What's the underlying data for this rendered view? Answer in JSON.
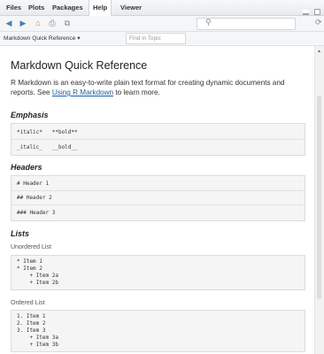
{
  "tabs": [
    "Files",
    "Plots",
    "Packages",
    "Help",
    "Viewer"
  ],
  "active_tab": "Help",
  "topic": "Markdown Quick Reference",
  "find_placeholder": "Find in Topic",
  "doc": {
    "title": "Markdown Quick Reference",
    "intro_text": "R Markdown is an easy-to-write plain text format for creating dynamic documents and reports. See ",
    "intro_link": "Using R Markdown",
    "intro_tail": " to learn more.",
    "emphasis": {
      "heading": "Emphasis",
      "lines": [
        "*italic*   **bold**",
        "_italic_   __bold__"
      ]
    },
    "headers": {
      "heading": "Headers",
      "lines": [
        "# Header 1",
        "## Header 2",
        "### Header 3"
      ]
    },
    "lists": {
      "heading": "Lists",
      "unordered_label": "Unordered List",
      "unordered_lines": [
        "* Item 1",
        "* Item 2",
        "    + Item 2a",
        "    + Item 2b"
      ],
      "ordered_label": "Ordered List",
      "ordered_lines": [
        "1. Item 1",
        "2. Item 2",
        "3. Item 3",
        "    + Item 3a",
        "    + Item 3b"
      ]
    }
  }
}
